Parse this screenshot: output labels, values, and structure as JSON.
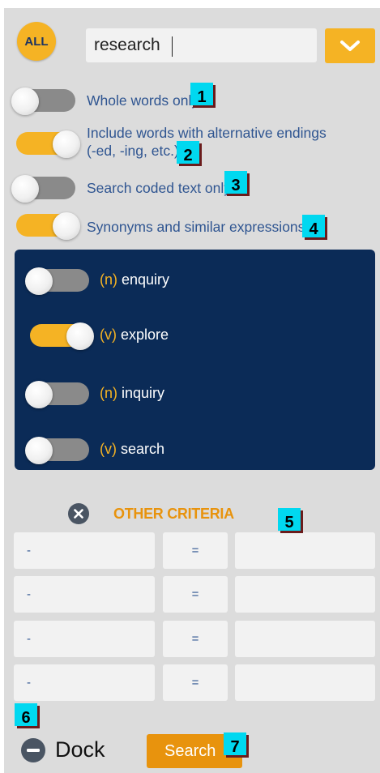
{
  "search": {
    "scope_label": "ALL",
    "query": "research"
  },
  "options": [
    {
      "label": "Whole words only",
      "on": false
    },
    {
      "label": "Include words with alternative endings",
      "label2": "(-ed, -ing, etc.)",
      "on": true
    },
    {
      "label": "Search coded text only.",
      "on": false
    },
    {
      "label": "Synonyms and similar expressions.",
      "on": true
    }
  ],
  "synonyms": [
    {
      "pos": "(n)",
      "word": "enquiry",
      "on": false
    },
    {
      "pos": "(v)",
      "word": "explore",
      "on": true
    },
    {
      "pos": "(n)",
      "word": "inquiry",
      "on": false
    },
    {
      "pos": "(v)",
      "word": "search",
      "on": false
    }
  ],
  "other_criteria": {
    "title": "OTHER CRITERIA",
    "rows": [
      {
        "field": "-",
        "op": "=",
        "value": ""
      },
      {
        "field": "-",
        "op": "=",
        "value": ""
      },
      {
        "field": "-",
        "op": "=",
        "value": ""
      },
      {
        "field": "-",
        "op": "=",
        "value": ""
      }
    ]
  },
  "footer": {
    "dock_label": "Dock",
    "search_label": "Search"
  },
  "markers": [
    "1",
    "2",
    "3",
    "4",
    "5",
    "6",
    "7"
  ],
  "colors": {
    "accent": "#f5b324",
    "orange": "#e8930d",
    "navy": "#0b2b57",
    "link": "#2f5591",
    "marker": "#00d8f0"
  },
  "icons": {
    "dropdown": "chevron-down-icon",
    "clear": "close-circle-icon",
    "dock": "minus-circle-icon"
  }
}
